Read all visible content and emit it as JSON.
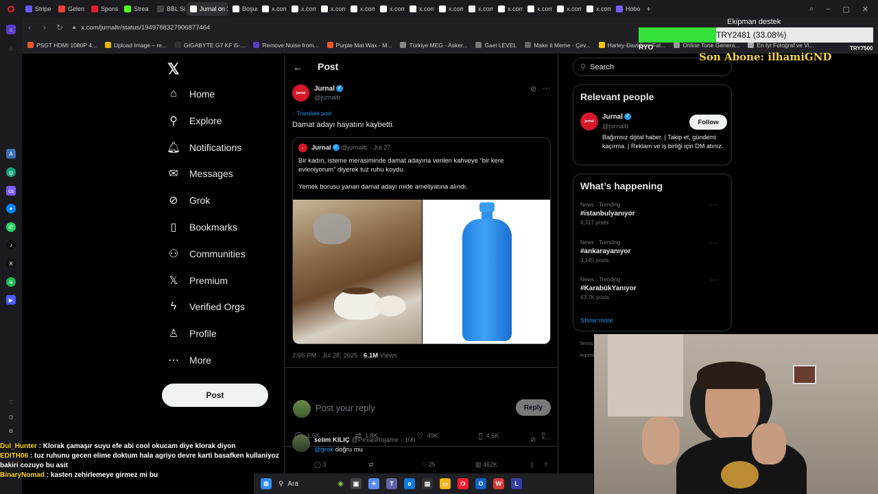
{
  "browser": {
    "tabs": [
      {
        "label": "Stripe",
        "color": "#635bff",
        "active": false
      },
      {
        "label": "Gelen",
        "color": "#ea4335",
        "active": false
      },
      {
        "label": "Spons",
        "color": "#e21b2b",
        "active": false
      },
      {
        "label": "Strea",
        "color": "#53fc18",
        "active": false
      },
      {
        "label": "BBL Si",
        "color": "#444",
        "active": false
      },
      {
        "label": "Jurnal on X",
        "color": "#ffffff",
        "active": true
      },
      {
        "label": "Boşun",
        "color": "#ffffff",
        "active": false
      },
      {
        "label": "x.com",
        "color": "#ffffff",
        "active": false
      },
      {
        "label": "x.com",
        "color": "#ffffff",
        "active": false
      },
      {
        "label": "x.com",
        "color": "#ffffff",
        "active": false
      },
      {
        "label": "x.com",
        "color": "#ffffff",
        "active": false
      },
      {
        "label": "x.com",
        "color": "#ffffff",
        "active": false
      },
      {
        "label": "x.com",
        "color": "#ffffff",
        "active": false
      },
      {
        "label": "x.com",
        "color": "#ffffff",
        "active": false
      },
      {
        "label": "x.com",
        "color": "#ffffff",
        "active": false
      },
      {
        "label": "x.com",
        "color": "#ffffff",
        "active": false
      },
      {
        "label": "x.com",
        "color": "#ffffff",
        "active": false
      },
      {
        "label": "x.com",
        "color": "#ffffff",
        "active": false
      },
      {
        "label": "x.com",
        "color": "#ffffff",
        "active": false
      },
      {
        "label": "Hobo",
        "color": "#7b5cff",
        "active": false
      }
    ],
    "url": "x.com/jurnaltr/status/1949788327906877464",
    "bookmarks": [
      {
        "label": "PSGT HDMI 1080P 4...",
        "color": "#e8572a"
      },
      {
        "label": "Upload Image – re...",
        "color": "#e6b800"
      },
      {
        "label": "GIGABYTE G7 KF i5-...",
        "color": "#333"
      },
      {
        "label": "Remove Noise from...",
        "color": "#5b3cc4"
      },
      {
        "label": "Purple Mat Wax - M...",
        "color": "#e8572a"
      },
      {
        "label": "Türkiye MEG - Asker...",
        "color": "#888"
      },
      {
        "label": "Gael LEVEL",
        "color": "#777"
      },
      {
        "label": "Make it Meme - Çev...",
        "color": "#666"
      },
      {
        "label": "Harley-Davidson Fat...",
        "color": "#f1c40f"
      },
      {
        "label": "Online Tone Genera...",
        "color": "#999"
      },
      {
        "label": "En İyi Fotoğraf ve Vi...",
        "color": "#aaa"
      }
    ]
  },
  "nav": {
    "items": [
      {
        "label": "Home",
        "icon": "⌂",
        "name": "home"
      },
      {
        "label": "Explore",
        "icon": "⚲",
        "name": "explore"
      },
      {
        "label": "Notifications",
        "icon": "🔔︎",
        "name": "notifications"
      },
      {
        "label": "Messages",
        "icon": "✉",
        "name": "messages"
      },
      {
        "label": "Grok",
        "icon": "⊘",
        "name": "grok"
      },
      {
        "label": "Bookmarks",
        "icon": "▯",
        "name": "bookmarks"
      },
      {
        "label": "Communities",
        "icon": "⚇",
        "name": "communities"
      },
      {
        "label": "Premium",
        "icon": "𝕏",
        "name": "premium"
      },
      {
        "label": "Verified Orgs",
        "icon": "ϟ",
        "name": "verified-orgs"
      },
      {
        "label": "Profile",
        "icon": "♙",
        "name": "profile"
      },
      {
        "label": "More",
        "icon": "⋯",
        "name": "more"
      }
    ],
    "post_button": "Post"
  },
  "main": {
    "header_title": "Post",
    "author": {
      "name": "Jurnal",
      "handle": "@jurnaltr",
      "avatar_text": "jurnal"
    },
    "translate": "Translate post",
    "text": "Damat adayı hayatını kaybetti.",
    "quote": {
      "name": "Jurnal",
      "handle": "@jurnaltr",
      "date": "· Jul 27",
      "text1": "Bir kadın, isteme merasiminde damat adayına verilen kahveye “bir kere evleniyorum” diyerek tuz ruhu koydu.",
      "text2": "Yemek borusu yanan damat adayı mide ameliyatına alındı."
    },
    "timestamp": "2:05 PM · Jul 28, 2025 · ",
    "views_count": "6.1M",
    "views_label": " Views",
    "actions": {
      "replies": "1.5K",
      "reposts": "1.8K",
      "likes": "49K",
      "bookmarks": "4.5K"
    },
    "reply_placeholder": "Post your reply",
    "reply_button": "Reply",
    "reply": {
      "name": "selim KILIÇ",
      "handle": "@PexasRojame · 10h",
      "mention": "@grok",
      "text": " doğru mu",
      "replies": "3",
      "likes": "25",
      "views": "462K"
    }
  },
  "right": {
    "search_placeholder": "Search",
    "relevant_title": "Relevant people",
    "person": {
      "name": "Jurnal",
      "handle": "@jurnaltr",
      "bio": "Bağımsız dijital haber. | Takip et, gündemi kaçırma. | Reklam ve iş birliği için DM atınız.",
      "follow": "Follow"
    },
    "happening_title": "What’s happening",
    "trends": [
      {
        "meta": "News · Trending",
        "tag": "#istanbulyanıyor",
        "count": "4,317 posts"
      },
      {
        "meta": "News · Trending",
        "tag": "#ankarayanıyor",
        "count": "3,145 posts"
      },
      {
        "meta": "News · Trending",
        "tag": "#KarabükYanıyor",
        "count": "43.7K posts"
      }
    ],
    "show_more": "Show more",
    "footer1": "Terms",
    "footer2": "Imprint"
  },
  "overlay": {
    "donation_title": "Ekipman destek",
    "donation_text": "TRY2481 (33.08%)",
    "donation_progress": 0.3308,
    "ryo": "RYO",
    "try_goal": "TRY7500",
    "last_sub": "Son Abone: ilhamiGND",
    "chat": [
      {
        "user": "Dul_Hunter",
        "color": "#ffd700",
        "msg": " : Klorak çamaşır suyu efe abi cool okucam diye klorak diyon"
      },
      {
        "user": "EDITH06",
        "color": "#ffd700",
        "msg": " : tuz ruhunu gecen elime doktum hala agriyo devre karti basafken kullaniyoz bakiri cozuyo bu asit"
      },
      {
        "user": "BinaryNomad",
        "color": "#ffd700",
        "msg": " : kasten zehirlemeye girmez mi bu"
      }
    ],
    "taskbar_search": "Ara"
  }
}
